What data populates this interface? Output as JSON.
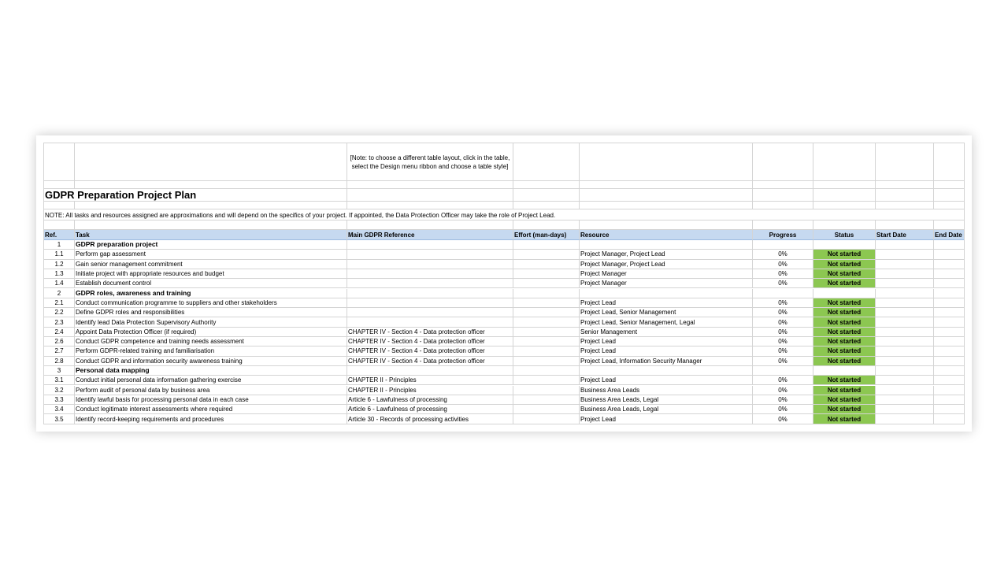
{
  "note": "[Note: to choose a different table layout,  click in the table, select the Design menu ribbon and choose a  table style]",
  "title": "GDPR Preparation Project Plan",
  "disclaimer": "NOTE: All tasks and resources assigned are approximations and will depend on the specifics of your project. If appointed, the Data Protection Officer may take the role of Project Lead.",
  "columns": [
    "Ref.",
    "Task",
    "Main GDPR Reference",
    "Effort (man-days)",
    "Resource",
    "Progress",
    "Status",
    "Start Date",
    "End Date"
  ],
  "colors": {
    "header_bg": "#c6d9f0",
    "status_not_started": "#8cc751"
  },
  "rows": [
    {
      "type": "section",
      "ref": "1",
      "task": "GDPR preparation project"
    },
    {
      "type": "task",
      "ref": "1.1",
      "task": "Perform gap assessment",
      "reference": "",
      "resource": "Project Manager, Project Lead",
      "progress": "0%",
      "status": "Not started"
    },
    {
      "type": "task",
      "ref": "1.2",
      "task": "Gain senior management commitment",
      "reference": "",
      "resource": "Project Manager, Project Lead",
      "progress": "0%",
      "status": "Not started"
    },
    {
      "type": "task",
      "ref": "1.3",
      "task": "Initiate project with appropriate resources and budget",
      "reference": "",
      "resource": "Project Manager",
      "progress": "0%",
      "status": "Not started"
    },
    {
      "type": "task",
      "ref": "1.4",
      "task": "Establish document control",
      "reference": "",
      "resource": "Project Manager",
      "progress": "0%",
      "status": "Not started"
    },
    {
      "type": "section",
      "ref": "2",
      "task": "GDPR roles, awareness and training"
    },
    {
      "type": "task",
      "ref": "2.1",
      "task": "Conduct communication programme to suppliers and other stakeholders",
      "reference": "",
      "resource": "Project Lead",
      "progress": "0%",
      "status": "Not started"
    },
    {
      "type": "task",
      "ref": "2.2",
      "task": "Define GDPR roles and responsibilities",
      "reference": "",
      "resource": "Project Lead, Senior Management",
      "progress": "0%",
      "status": "Not started"
    },
    {
      "type": "task",
      "ref": "2.3",
      "task": "Identify lead Data Protection Supervisory Authority",
      "reference": "",
      "resource": "Project Lead, Senior Management, Legal",
      "progress": "0%",
      "status": "Not started"
    },
    {
      "type": "task",
      "ref": "2.4",
      "task": "Appoint Data Protection Officer (if required)",
      "reference": "CHAPTER IV - Section 4 - Data protection officer",
      "resource": "Senior Management",
      "progress": "0%",
      "status": "Not started"
    },
    {
      "type": "task",
      "ref": "2.6",
      "task": "Conduct GDPR competence and training needs assessment",
      "reference": "CHAPTER IV - Section 4 - Data protection officer",
      "resource": "Project Lead",
      "progress": "0%",
      "status": "Not started"
    },
    {
      "type": "task",
      "ref": "2.7",
      "task": "Perform GDPR-related training and familiarisation",
      "reference": "CHAPTER IV - Section 4 - Data protection officer",
      "resource": "Project Lead",
      "progress": "0%",
      "status": "Not started"
    },
    {
      "type": "task",
      "ref": "2.8",
      "task": "Conduct GDPR and information security awareness training",
      "reference": "CHAPTER IV - Section 4 - Data protection officer",
      "resource": "Project Lead, Information Security Manager",
      "progress": "0%",
      "status": "Not started"
    },
    {
      "type": "section",
      "ref": "3",
      "task": "Personal data mapping"
    },
    {
      "type": "task",
      "ref": "3.1",
      "task": "Conduct initial personal data information gathering exercise",
      "reference": "CHAPTER II - Principles",
      "resource": "Project Lead",
      "progress": "0%",
      "status": "Not started"
    },
    {
      "type": "task",
      "ref": "3.2",
      "task": "Perform audit of personal data by business area",
      "reference": "CHAPTER II - Principles",
      "resource": "Business Area Leads",
      "progress": "0%",
      "status": "Not started"
    },
    {
      "type": "task",
      "ref": "3.3",
      "task": "Identify lawful basis for processing personal data in each case",
      "reference": "Article 6 - Lawfulness of processing",
      "resource": "Business Area Leads, Legal",
      "progress": "0%",
      "status": "Not started"
    },
    {
      "type": "task",
      "ref": "3.4",
      "task": "Conduct legitimate interest assessments where required",
      "reference": "Article 6 - Lawfulness of processing",
      "resource": "Business Area Leads, Legal",
      "progress": "0%",
      "status": "Not started"
    },
    {
      "type": "task",
      "ref": "3.5",
      "task": "Identify record-keeping requirements and procedures",
      "reference": "Article 30 - Records of processing activities",
      "resource": "Project Lead",
      "progress": "0%",
      "status": "Not started"
    }
  ]
}
